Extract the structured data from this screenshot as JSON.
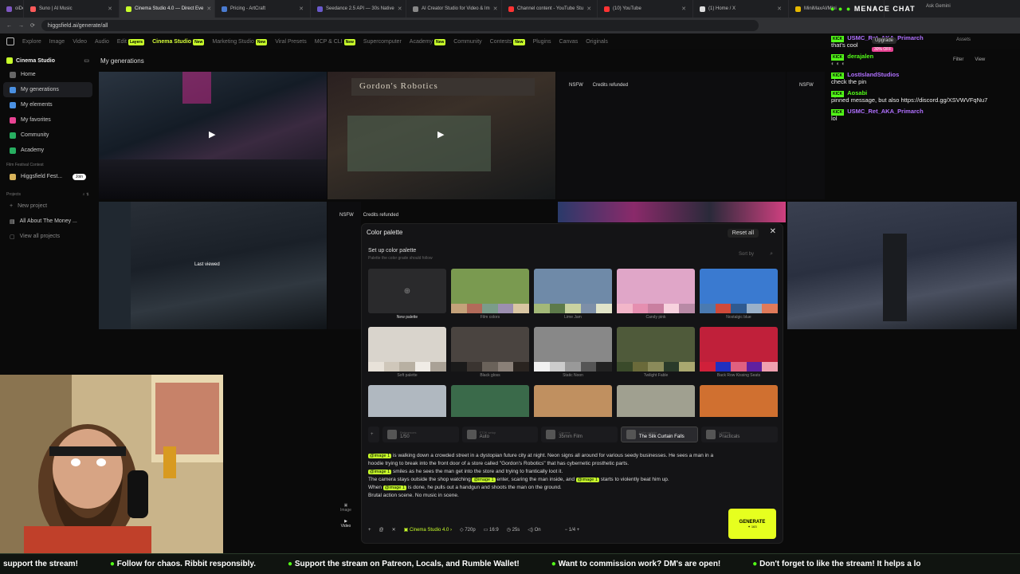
{
  "browser": {
    "tabs": [
      {
        "label": "oiDev",
        "color": "#7e57c2"
      },
      {
        "label": "Suno | AI Music",
        "color": "#ff5a5a"
      },
      {
        "label": "Cinema Studio 4.0 — Direct Eve",
        "color": "#c8ff2a",
        "active": true
      },
      {
        "label": "Pricing - ArtCraft",
        "color": "#4a7bd0"
      },
      {
        "label": "Seedance 2.5 API — 30s Native",
        "color": "#6a5acd"
      },
      {
        "label": "AI Creator Studio for Video & Im",
        "color": "#888888"
      },
      {
        "label": "Channel content - YouTube Stu",
        "color": "#ff3333"
      },
      {
        "label": "(10) YouTube",
        "color": "#ff3333"
      },
      {
        "label": "(1) Home / X",
        "color": "#dddddd"
      },
      {
        "label": "MiniMaxAI/Mini",
        "color": "#e6b800"
      }
    ],
    "url": "higgsfield.ai/generate/all",
    "ask": "Ask Gemini"
  },
  "sitenav": {
    "items": [
      "Explore",
      "Image",
      "Video",
      "Audio",
      "Edit",
      "Cinema Studio",
      "Marketing Studio",
      "Viral Presets",
      "MCP & CLI",
      "Supercomputer",
      "Academy",
      "Community",
      "Contests",
      "Plugins",
      "Canvas",
      "Originals"
    ],
    "layers": "Layers",
    "new": "New",
    "upgrade": "Upgrade",
    "off": "30% OFF",
    "assets": "Assets",
    "filter": "Filter",
    "view": "View"
  },
  "sidebar": {
    "title": "Cinema Studio",
    "items": [
      {
        "label": "Home",
        "color": "#666666"
      },
      {
        "label": "My generations",
        "color": "#4a90e2"
      },
      {
        "label": "My elements",
        "color": "#4a90e2"
      },
      {
        "label": "My favorites",
        "color": "#e84393"
      },
      {
        "label": "Community",
        "color": "#27ae60"
      },
      {
        "label": "Academy",
        "color": "#27ae60"
      }
    ],
    "festival_label": "Film Festival Contest",
    "festival_item": "Higgsfield Fest...",
    "join": "Join",
    "projects_label": "Projects",
    "new_project": "New project",
    "project1": "All About The Money ...",
    "view_all": "View all projects"
  },
  "page": {
    "title": "My generations",
    "nsfw": "NSFW",
    "refunded": "Credits refunded",
    "last_viewed": "Last viewed",
    "sign": "Gordon's Robotics"
  },
  "panel": {
    "title": "Color palette",
    "reset": "Reset all",
    "setup": "Set up color palette",
    "setup_sub": "Palette the color grade should follow",
    "sort": "Sort by",
    "palettes": [
      {
        "label": "New palette",
        "img": "#2a2a2c",
        "sw": [
          "#2a2a2c",
          "#2a2a2c",
          "#2a2a2c",
          "#2a2a2c",
          "#2a2a2c"
        ]
      },
      {
        "label": "Film colors",
        "img": "#7a9a50",
        "sw": [
          "#c4a27a",
          "#b26b5a",
          "#7b9c8a",
          "#9c8fb0",
          "#d9c6a3"
        ]
      },
      {
        "label": "Lime Jam",
        "img": "#6f8aa8",
        "sw": [
          "#a3b878",
          "#5d7a4a",
          "#c9d2a0",
          "#7d8fa8",
          "#e1e4c9"
        ]
      },
      {
        "label": "Candy pink",
        "img": "#e0a6c8",
        "sw": [
          "#f2b6c9",
          "#e58fb0",
          "#c97fa0",
          "#f7d2de",
          "#b88aa6"
        ]
      },
      {
        "label": "Nostalgic blue",
        "img": "#3a7ad0",
        "sw": [
          "#4a7ab0",
          "#d04a3a",
          "#2f5a90",
          "#9ab0c8",
          "#e07a5a"
        ]
      },
      {
        "label": "Soft palette",
        "img": "#d9d4cc",
        "sw": [
          "#e8e2d9",
          "#cfc7ba",
          "#b8b0a2",
          "#f0ece6",
          "#a9a196"
        ]
      },
      {
        "label": "Black gloss",
        "img": "#4a4440",
        "sw": [
          "#1a1a1a",
          "#3a3430",
          "#6a625a",
          "#8a8078",
          "#2a2420"
        ]
      },
      {
        "label": "Static Noon",
        "img": "#888888",
        "sw": [
          "#f0f0f0",
          "#cccccc",
          "#999999",
          "#555555",
          "#222222"
        ]
      },
      {
        "label": "Twilight Fable",
        "img": "#4f5a3a",
        "sw": [
          "#3a4a2a",
          "#6a6a3a",
          "#8a8a5a",
          "#2a3a2a",
          "#aaa870"
        ]
      },
      {
        "label": "Back Row Kissing Seats",
        "img": "#c0203a",
        "sw": [
          "#d0203a",
          "#2030c0",
          "#e06080",
          "#6020a0",
          "#f0a0b0"
        ]
      },
      {
        "label": "",
        "img": "#b0b8c0",
        "sw": []
      },
      {
        "label": "",
        "img": "#3a6a4a",
        "sw": []
      },
      {
        "label": "",
        "img": "#c09060",
        "sw": []
      },
      {
        "label": "",
        "img": "#a0a090",
        "sw": []
      },
      {
        "label": "",
        "img": "#d07030",
        "sw": []
      }
    ],
    "toolbar": [
      {
        "cap": "References",
        "val": "1/50"
      },
      {
        "cap": "FT2K setup",
        "val": "Auto"
      },
      {
        "cap": "Camera",
        "val": "35mm Film"
      },
      {
        "cap": "Color palette",
        "val": "The Silk Curtain Falls",
        "sel": true
      },
      {
        "cap": "Lighting",
        "val": "Practicals"
      }
    ],
    "prompt": [
      {
        "m": "@image 1",
        "t": " is walking down a crowded street in a dystopian future city at night. Neon signs all around for various seedy businesses. He sees a man in a hoodie trying to break into the front door of a store called \"Gordon's Robotics\" that has cybernetic prosthetic parts."
      },
      {
        "m": "@image 1",
        "t": " smiles as he sees the man get into the store and trying to frantically loot it."
      },
      {
        "pre": "The camera stays outside the shop watching ",
        "m": "@image 1",
        "t": " enter, scaring the man inside, and ",
        "m2": "@image 1",
        "t2": " starts to violently beat him up."
      },
      {
        "pre": "When ",
        "m": "@image 1",
        "t": " is done, he pulls out a handgun and shoots the man on the ground."
      },
      {
        "t": "Brutal action scene. No music in scene."
      }
    ],
    "modes": [
      "Image",
      "Video"
    ],
    "bottom": {
      "model": "Cinema Studio 4.0",
      "res": "720p",
      "ratio": "16:9",
      "dur": "25s",
      "audio": "On",
      "count": "1/4"
    },
    "generate": "GENERATE",
    "credits": "163"
  },
  "chat": {
    "title": "MENACE CHAT",
    "messages": [
      {
        "user": "USMC_Ret_AKA_Primarch",
        "color": "#b070ff",
        "text": "that's cool"
      },
      {
        "user": "derajalen",
        "color": "#53fc18",
        "text": ""
      },
      {
        "user": "LostIslandStudios",
        "color": "#b070ff",
        "text": "check the pin"
      },
      {
        "user": "Aosabi",
        "color": "#53fc18",
        "text": "pinned message, but also https://discord.gg/XSVWVFqNu7"
      },
      {
        "user": "USMC_Ret_AKA_Primarch",
        "color": "#b070ff",
        "text": "lol"
      }
    ],
    "kick": "KICK"
  },
  "ticker": [
    "support the stream!",
    "Follow for chaos. Ribbit responsibly.",
    "Support the stream on Patreon, Locals, and Rumble Wallet!",
    "Want to commission work? DM's are open!",
    "Don't forget to like the stream! It helps a lo"
  ]
}
